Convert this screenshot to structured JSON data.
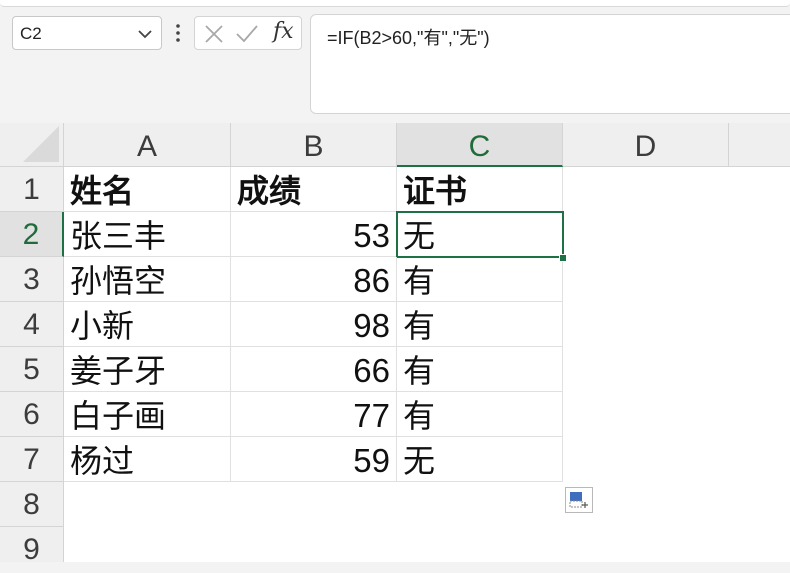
{
  "name_box": {
    "value": "C2"
  },
  "formula_bar": {
    "fx_label": "fx",
    "formula": "=IF(B2>60,\"有\",\"无\")"
  },
  "columns": [
    "A",
    "B",
    "C",
    "D"
  ],
  "selected_column": "C",
  "rows": [
    "1",
    "2",
    "3",
    "4",
    "5",
    "6",
    "7",
    "8",
    "9"
  ],
  "selected_row": "2",
  "table": {
    "header": [
      "姓名",
      "成绩",
      "证书"
    ],
    "rows": [
      [
        "张三丰",
        "53",
        "无"
      ],
      [
        "孙悟空",
        "86",
        "有"
      ],
      [
        "小新",
        "98",
        "有"
      ],
      [
        "姜子牙",
        "66",
        "有"
      ],
      [
        "白子画",
        "77",
        "有"
      ],
      [
        "杨过",
        "59",
        "无"
      ]
    ]
  },
  "active_cell": "C2",
  "colors": {
    "selection": "#1e7145",
    "header_bg": "#efefef"
  },
  "icons": [
    "chevron-down-icon",
    "more-vertical-icon",
    "cancel-icon",
    "confirm-icon",
    "quick-analysis-icon"
  ]
}
